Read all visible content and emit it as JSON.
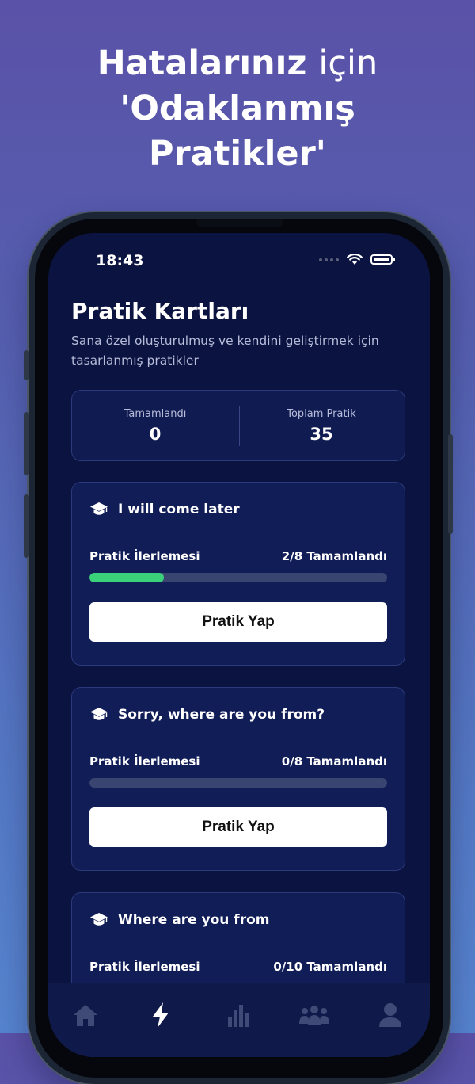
{
  "headline": {
    "line1_bold": "Hatalarınız",
    "line1_light": "için",
    "line2": "'Odaklanmış",
    "line3": "Pratikler'"
  },
  "status_bar": {
    "time": "18:43"
  },
  "page": {
    "title": "Pratik Kartları",
    "subtitle": "Sana özel oluşturulmuş ve kendini geliştirmek için tasarlanmış pratikler"
  },
  "stats": {
    "completed_label": "Tamamlandı",
    "completed_value": "0",
    "total_label": "Toplam Pratik",
    "total_value": "35"
  },
  "cards": [
    {
      "title": "I will come later",
      "progress_label": "Pratik İlerlemesi",
      "progress_text": "2/8 Tamamlandı",
      "progress_fraction": 0.25,
      "button_label": "Pratik Yap"
    },
    {
      "title": "Sorry, where are you from?",
      "progress_label": "Pratik İlerlemesi",
      "progress_text": "0/8 Tamamlandı",
      "progress_fraction": 0.0,
      "button_label": "Pratik Yap"
    },
    {
      "title": "Where are you from",
      "progress_label": "Pratik İlerlemesi",
      "progress_text": "0/10 Tamamlandı",
      "progress_fraction": 0.0
    }
  ],
  "tabbar": {
    "items": [
      {
        "icon": "home-icon",
        "active": false
      },
      {
        "icon": "lightning-icon",
        "active": true
      },
      {
        "icon": "bar-chart-icon",
        "active": false
      },
      {
        "icon": "community-icon",
        "active": false
      },
      {
        "icon": "profile-icon",
        "active": false
      }
    ]
  },
  "colors": {
    "accent_progress": "#3ad17a",
    "screen_background": "#0b1340",
    "card_background": "#111d57"
  }
}
